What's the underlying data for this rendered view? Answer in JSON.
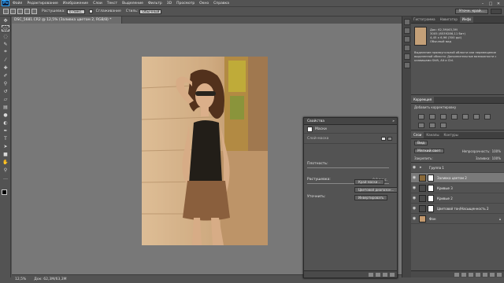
{
  "menu": {
    "logo": "Ps",
    "items": [
      "Файл",
      "Редактирование",
      "Изображение",
      "Слои",
      "Текст",
      "Выделение",
      "Фильтр",
      "3D",
      "Просмотр",
      "Окно",
      "Справка"
    ],
    "window_controls": [
      "–",
      "□",
      "✕"
    ]
  },
  "options": {
    "feather_label": "Растушевка:",
    "feather_value": "0 пикс.",
    "antialias_label": "Сглаживание",
    "style_label": "Стиль:",
    "style_value": "Обычный",
    "refine_button": "Уточн. край..."
  },
  "document": {
    "tab_title": "DSC_5681.CR2 @ 12,5% (Заливка цветом 2, RGB/8) *"
  },
  "status": {
    "zoom": "12,5%",
    "doc_size": "Док: 62,3M/63,3M"
  },
  "properties": {
    "title": "Свойства",
    "close": "»",
    "subtitle": "Маски",
    "layer_mask_label": "Слой-маска",
    "density_label": "Плотность:",
    "density_value": "",
    "feather_label": "Растушевка:",
    "feather_value": "0,0 пикс.",
    "refine_label": "Уточнить:",
    "mask_edge_button": "Край маски...",
    "color_range_button": "Цветовой диапазон...",
    "invert_button": "Инвертировать"
  },
  "top_panel": {
    "tabs": [
      "Гистограмма",
      "Навигатор",
      "Инфо"
    ],
    "active_tab": 2,
    "info_lines": [
      "Док: 62,3M/63,3M",
      "3005 (8539286,11 бит)",
      "4,45 x 6,96 (300 ppi)",
      "Обычный вид"
    ],
    "info_hint": "Выделение прямоугольной области или перемещение выделенной области. Дополнительные возможности с клавишами Shift, Alt и Ctrl."
  },
  "adjust_panel": {
    "tab": "Коррекция",
    "heading": "Добавить корректировку"
  },
  "layers_panel": {
    "tabs": [
      "Слои",
      "Каналы",
      "Контуры"
    ],
    "kind_label": "Вид",
    "blend_mode": "Мягкий свет",
    "opacity_label": "Непрозрачность:",
    "opacity_value": "100%",
    "lock_label": "Закрепить:",
    "fill_label": "Заливка:",
    "fill_value": "100%",
    "layers": [
      {
        "name": "Группа 1",
        "thumb": "folder",
        "selected": false
      },
      {
        "name": "Заливка цветом 2",
        "thumb": "color",
        "selected": true
      },
      {
        "name": "Кривые 3",
        "thumb": "curves",
        "selected": false
      },
      {
        "name": "Кривые 2",
        "thumb": "curves",
        "selected": false
      },
      {
        "name": "Цветовой тон/Насыщенность 2",
        "thumb": "hue",
        "selected": false
      },
      {
        "name": "Фон",
        "thumb": "photo",
        "selected": false
      }
    ]
  },
  "colors": {
    "fill_layer": "#8a6a3a",
    "photo_tone": "#d9b58d"
  }
}
